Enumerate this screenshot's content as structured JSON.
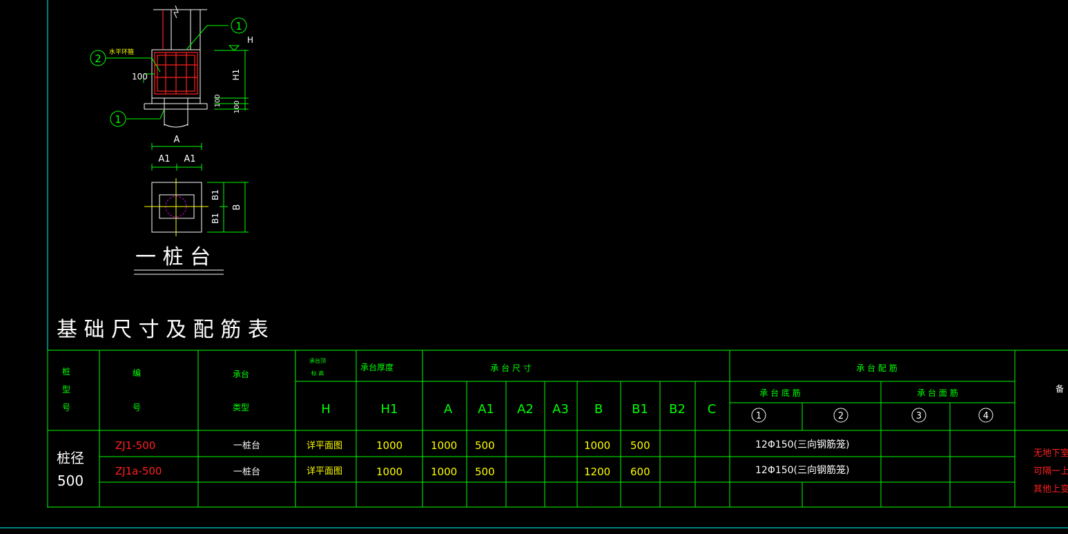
{
  "detail": {
    "callouts": [
      "1",
      "2",
      "1"
    ],
    "rebar_note": "水平环箍",
    "dim_100": "100",
    "dim_H": "H",
    "dim_H1": "H1",
    "dim_100a": "100",
    "dim_100b": "100",
    "dim_A": "A",
    "dim_A1_left": "A1",
    "dim_A1_right": "A1",
    "dim_B1_top": "B1",
    "dim_B1_bottom": "B1",
    "dim_B": "B",
    "plan_title": "一 桩 台"
  },
  "table": {
    "title": "基 础 尺 寸 及 配 筋 表",
    "headers": {
      "pile_type": "桩\n型\n号",
      "code": "编\n号",
      "cap_type": "承台\n类型",
      "cap_top_elev": "承台顶\n标 高",
      "cap_thickness": "承台厚度",
      "cap_size": "承 台 尺 寸",
      "cap_rebar": "承 台 配 筋",
      "bottom_rebar": "承 台 底 筋",
      "top_rebar": "承 台 面 筋",
      "remark": "备",
      "sub": [
        "H",
        "H1",
        "A",
        "A1",
        "A2",
        "A3",
        "B",
        "B1",
        "B2",
        "C"
      ],
      "rebar_cols": [
        "1",
        "2",
        "3",
        "4"
      ]
    },
    "group_label": "桩径\n500",
    "rows": [
      {
        "code": "ZJ1-500",
        "type": "一桩台",
        "H": "详平面图",
        "H1": "1000",
        "A": "1000",
        "A1": "500",
        "B": "1000",
        "B1": "500",
        "rebar": "12Φ150(三向钢筋笼)"
      },
      {
        "code": "ZJ1a-500",
        "type": "一桩台",
        "H": "详平面图",
        "H1": "1000",
        "A": "1000",
        "A1": "500",
        "B": "1200",
        "B1": "600",
        "rebar": "12Φ150(三向钢筋笼)"
      }
    ],
    "remark_lines": [
      "无地下室时",
      "可隔一上室",
      "其他上变经"
    ]
  },
  "colors": {
    "bg": "#000000",
    "frame": "#00ffff",
    "line": "#00ff00",
    "text": "#ffffff",
    "label": "#ffff00",
    "rebar": "#ff2020",
    "magenta": "#d000d0"
  }
}
